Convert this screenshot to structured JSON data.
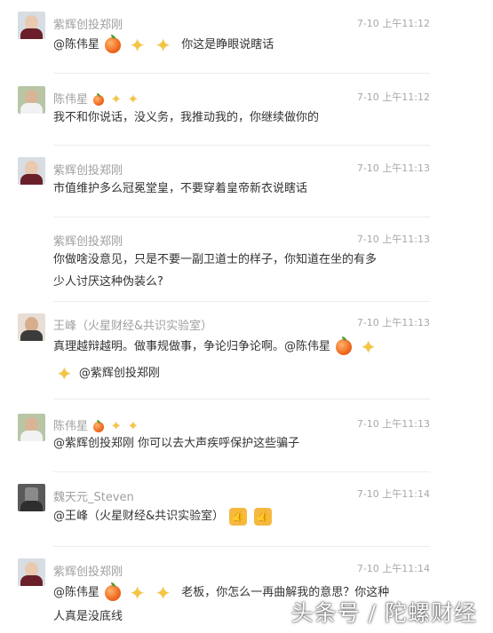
{
  "comments": [
    {
      "name": "紫辉创投郑刚",
      "time": "7-10 上午11:12",
      "text_before": "@陈伟星",
      "text_after": "你这是睁眼说瞎话"
    },
    {
      "name": "陈伟星",
      "time": "7-10 上午11:12",
      "text": "我不和你说话，没义务，我推动我的，你继续做你的"
    },
    {
      "name": "紫辉创投郑刚",
      "time": "7-10 上午11:13",
      "text": "市值维护多么冠冕堂皇，不要穿着皇帝新衣说瞎话"
    },
    {
      "name": "紫辉创投郑刚",
      "time": "7-10 上午11:13",
      "text_line1": "你做啥没意见，只是不要一副卫道士的样子，你知道在坐的有多",
      "text_line2": "少人讨厌这种伪装么?"
    },
    {
      "name": "王峰（火星财经&共识实验室）",
      "time": "7-10 上午11:13",
      "text": "真理越辩越明。做事规做事，争论归争论啊。@陈伟星",
      "mention2": "@紫辉创投郑刚"
    },
    {
      "name": "陈伟星",
      "time": "7-10 上午11:13",
      "text": "@紫辉创投郑刚 你可以去大声疾呼保护这些骗子"
    },
    {
      "name": "魏天元_Steven",
      "time": "7-10 上午11:14",
      "text": "@王峰（火星财经&共识实验室）"
    },
    {
      "name": "紫辉创投郑刚",
      "time": "7-10 上午11:14",
      "text_before": "@陈伟星",
      "text_after": "老板，你怎么一再曲解我的意思？你这种",
      "text_line2": "人真是没底线"
    }
  ],
  "icons": {
    "peach": "peach-icon",
    "star": "sparkle-star-icon",
    "thumb": "thumbs-up-icon"
  },
  "watermark": "头条号 / 陀螺财经"
}
